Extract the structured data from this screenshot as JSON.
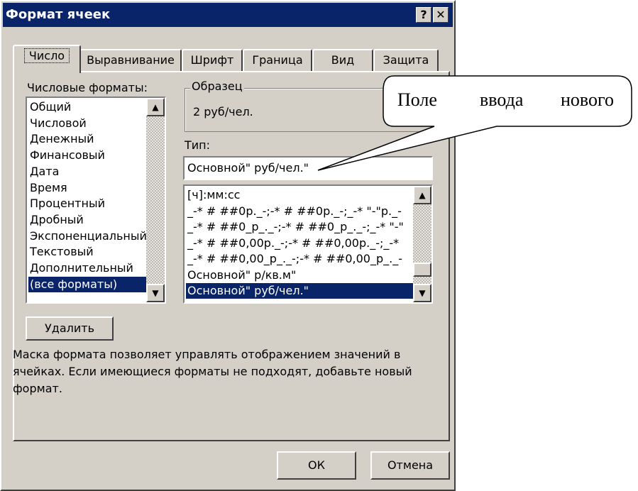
{
  "dialog": {
    "title": "Формат ячеек",
    "help_label": "?",
    "close_label": "✕"
  },
  "tabs": [
    {
      "label": "Число"
    },
    {
      "label": "Выравнивание"
    },
    {
      "label": "Шрифт"
    },
    {
      "label": "Граница"
    },
    {
      "label": "Вид"
    },
    {
      "label": "Защита"
    }
  ],
  "formats": {
    "label": "Числовые форматы:",
    "items": [
      "Общий",
      "Числовой",
      "Денежный",
      "Финансовый",
      "Дата",
      "Время",
      "Процентный",
      "Дробный",
      "Экспоненциальный",
      "Текстовый",
      "Дополнительный",
      "(все форматы)"
    ],
    "selected": "(все форматы)"
  },
  "sample": {
    "label": "Образец",
    "value": "2 руб/чел."
  },
  "type": {
    "label": "Тип:",
    "value": "Основной\" руб/чел.\"",
    "items": [
      "[ч]:мм:сс",
      "_-* # ##0р._-;-* # ##0р._-;_-* \"-\"р._-",
      "_-* # ##0_р_._-;-* # ##0_р_._-;_-* \"-\"",
      "_-* # ##0,00р._-;-* # ##0,00р._-;_-*",
      "_-* # ##0,00_р_._-;-* # ##0,00_р_._-",
      "Основной\" р/кв.м\"",
      "Основной\" руб/чел.\""
    ],
    "selected": "Основной\" руб/чел.\""
  },
  "delete_button": "Удалить",
  "description": [
    "Маска формата позволяет управлять отображением значений в",
    "ячейках. Если имеющиеся форматы не подходят, добавьте новый",
    "формат."
  ],
  "ok_button": "ОК",
  "cancel_button": "Отмена",
  "callout": {
    "words": [
      "Поле",
      "ввода",
      "нового"
    ]
  },
  "colors": {
    "titlebar": "#0a246a",
    "face": "#d4d0c8",
    "selection": "#0a246a"
  },
  "icons": {
    "scroll_up": "▲",
    "scroll_down": "▼"
  }
}
